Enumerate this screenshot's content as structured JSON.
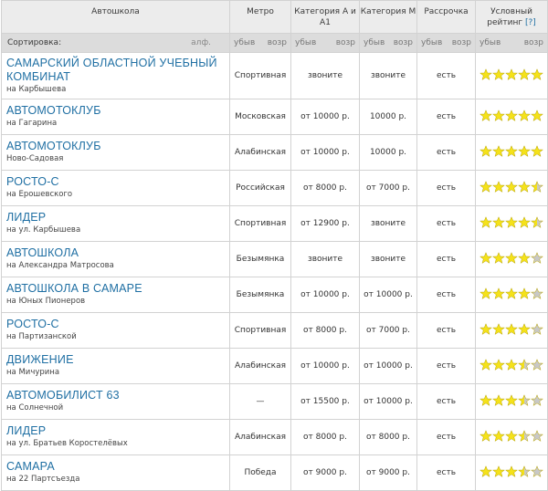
{
  "header": {
    "school": "Автошкола",
    "metro": "Метро",
    "cat_a": "Категория А и А1",
    "cat_m": "Категория М",
    "installment": "Рассрочка",
    "rating_line1": "Условный",
    "rating_line2": "рейтинг",
    "rating_help": "[?]"
  },
  "sort": {
    "label": "Сортировка:",
    "alpha": "алф.",
    "desc": "убыв",
    "asc": "возр"
  },
  "colors": {
    "star_full": "#f5e21a",
    "star_empty": "#c8c8c8",
    "name": "#1f6fa3"
  },
  "rows": [
    {
      "name": "САМАРСКИЙ ОБЛАСТНОЙ УЧЕБНЫЙ КОМБИНАТ",
      "address": "на Карбышева",
      "metro": "Спортивная",
      "cat_a": "звоните",
      "cat_m": "звоните",
      "installment": "есть",
      "rating": 5
    },
    {
      "name": "АВТОМОТОКЛУБ",
      "address": "на Гагарина",
      "metro": "Московская",
      "cat_a": "от 10000 р.",
      "cat_m": "10000 р.",
      "installment": "есть",
      "rating": 5
    },
    {
      "name": "АВТОМОТОКЛУБ",
      "address": "Ново-Садовая",
      "metro": "Алабинская",
      "cat_a": "от 10000 р.",
      "cat_m": "10000 р.",
      "installment": "есть",
      "rating": 5
    },
    {
      "name": "РОСТО-С",
      "address": "на Ерошевского",
      "metro": "Российская",
      "cat_a": "от 8000 р.",
      "cat_m": "от 7000 р.",
      "installment": "есть",
      "rating": 4.5
    },
    {
      "name": "ЛИДЕР",
      "address": "на ул. Карбышева",
      "metro": "Спортивная",
      "cat_a": "от 12900 р.",
      "cat_m": "звоните",
      "installment": "есть",
      "rating": 4.5
    },
    {
      "name": "АВТОШКОЛА",
      "address": "на Александра Матросова",
      "metro": "Безымянка",
      "cat_a": "звоните",
      "cat_m": "звоните",
      "installment": "есть",
      "rating": 4
    },
    {
      "name": "АВТОШКОЛА В САМАРЕ",
      "address": "на Юных Пионеров",
      "metro": "Безымянка",
      "cat_a": "от 10000 р.",
      "cat_m": "от 10000 р.",
      "installment": "есть",
      "rating": 4
    },
    {
      "name": "РОСТО-С",
      "address": "на Партизанской",
      "metro": "Спортивная",
      "cat_a": "от 8000 р.",
      "cat_m": "от 7000 р.",
      "installment": "есть",
      "rating": 4
    },
    {
      "name": "ДВИЖЕНИЕ",
      "address": "на Мичурина",
      "metro": "Алабинская",
      "cat_a": "от 10000 р.",
      "cat_m": "от 10000 р.",
      "installment": "есть",
      "rating": 3.5
    },
    {
      "name": "АВТОМОБИЛИСТ 63",
      "address": "на Солнечной",
      "metro": "—",
      "cat_a": "от 15500 р.",
      "cat_m": "от 10000 р.",
      "installment": "есть",
      "rating": 3.5
    },
    {
      "name": "ЛИДЕР",
      "address": "на ул. Братьев Коростелёвых",
      "metro": "Алабинская",
      "cat_a": "от 8000 р.",
      "cat_m": "от 8000 р.",
      "installment": "есть",
      "rating": 3.5
    },
    {
      "name": "САМАРА",
      "address": "на 22 Партсъезда",
      "metro": "Победа",
      "cat_a": "от 9000 р.",
      "cat_m": "от 9000 р.",
      "installment": "есть",
      "rating": 3.5
    }
  ]
}
